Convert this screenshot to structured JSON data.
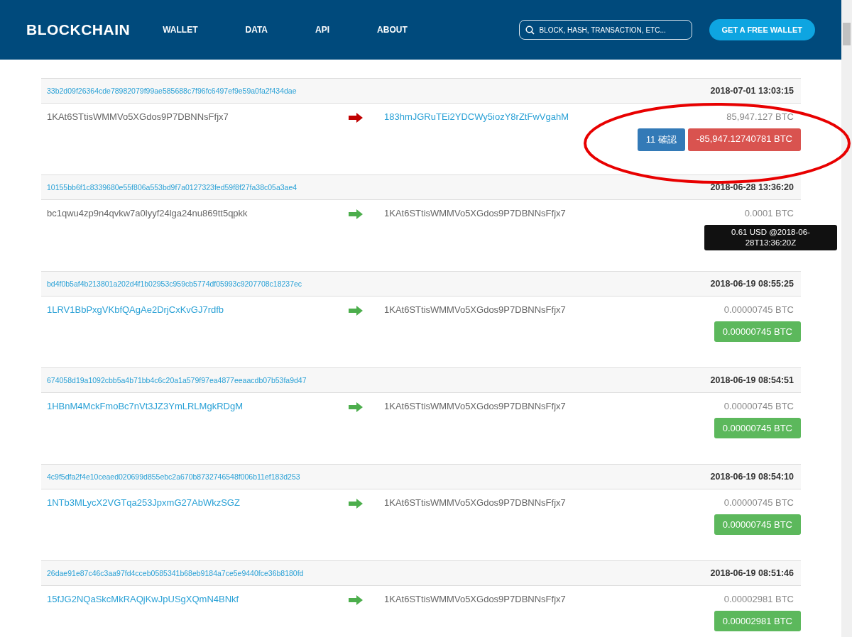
{
  "header": {
    "logo": "BLOCKCHAIN",
    "nav": [
      "WALLET",
      "DATA",
      "API",
      "ABOUT"
    ],
    "search": {
      "placeholder": "BLOCK, HASH, TRANSACTION, ETC..."
    },
    "cta": "GET A FREE WALLET"
  },
  "transactions": [
    {
      "hash": "33b2d09f26364cde78982079f99ae585688c7f96fc6497ef9e59a0fa2f434dae",
      "time": "2018-07-01 13:03:15",
      "from": {
        "text": "1KAt6STtisWMMVo5XGdos9P7DBNNsFfjx7",
        "link": false
      },
      "outgoing": true,
      "to": {
        "text": "183hmJGRuTEi2YDCWy5iozY8rZtFwVgahM",
        "link": true
      },
      "amount": "85,947.127 BTC",
      "confirmations": "11 確認",
      "result": {
        "text": "-85,947.12740781 BTC",
        "kind": "negative"
      },
      "circled": true
    },
    {
      "hash": "10155bb6f1c8339680e55f806a553bd9f7a0127323fed59f8f27fa38c05a3ae4",
      "time": "2018-06-28 13:36:20",
      "from": {
        "text": "bc1qwu4zp9n4qvkw7a0lyyf24lga24nu869tt5qpkk",
        "link": false
      },
      "outgoing": false,
      "to": {
        "text": "1KAt6STtisWMMVo5XGdos9P7DBNNsFfjx7",
        "link": false
      },
      "amount": "0.0001 BTC",
      "tooltip": "0.61 USD @2018-06-28T13:36:20Z",
      "circled": false
    },
    {
      "hash": "bd4f0b5af4b213801a202d4f1b02953c959cb5774df05993c9207708c18237ec",
      "time": "2018-06-19 08:55:25",
      "from": {
        "text": "1LRV1BbPxgVKbfQAgAe2DrjCxKvGJ7rdfb",
        "link": true
      },
      "outgoing": false,
      "to": {
        "text": "1KAt6STtisWMMVo5XGdos9P7DBNNsFfjx7",
        "link": false
      },
      "amount": "0.00000745 BTC",
      "result": {
        "text": "0.00000745 BTC",
        "kind": "positive"
      },
      "circled": false
    },
    {
      "hash": "674058d19a1092cbb5a4b71bb4c6c20a1a579f97ea4877eeaacdb07b53fa9d47",
      "time": "2018-06-19 08:54:51",
      "from": {
        "text": "1HBnM4MckFmoBc7nVt3JZ3YmLRLMgkRDgM",
        "link": true
      },
      "outgoing": false,
      "to": {
        "text": "1KAt6STtisWMMVo5XGdos9P7DBNNsFfjx7",
        "link": false
      },
      "amount": "0.00000745 BTC",
      "result": {
        "text": "0.00000745 BTC",
        "kind": "positive"
      },
      "circled": false
    },
    {
      "hash": "4c9f5dfa2f4e10ceaed020699d855ebc2a670b8732746548f006b11ef183d253",
      "time": "2018-06-19 08:54:10",
      "from": {
        "text": "1NTb3MLycX2VGTqa253JpxmG27AbWkzSGZ",
        "link": true
      },
      "outgoing": false,
      "to": {
        "text": "1KAt6STtisWMMVo5XGdos9P7DBNNsFfjx7",
        "link": false
      },
      "amount": "0.00000745 BTC",
      "result": {
        "text": "0.00000745 BTC",
        "kind": "positive"
      },
      "circled": false
    },
    {
      "hash": "26dae91e87c46c3aa97fd4cceb0585341b68eb9184a7ce5e9440fce36b8180fd",
      "time": "2018-06-19 08:51:46",
      "from": {
        "text": "15fJG2NQaSkcMkRAQjKwJpUSgXQmN4BNkf",
        "link": true
      },
      "outgoing": false,
      "to": {
        "text": "1KAt6STtisWMMVo5XGdos9P7DBNNsFfjx7",
        "link": false
      },
      "amount": "0.00002981 BTC",
      "result": {
        "text": "0.00002981 BTC",
        "kind": "positive"
      },
      "circled": false
    }
  ]
}
